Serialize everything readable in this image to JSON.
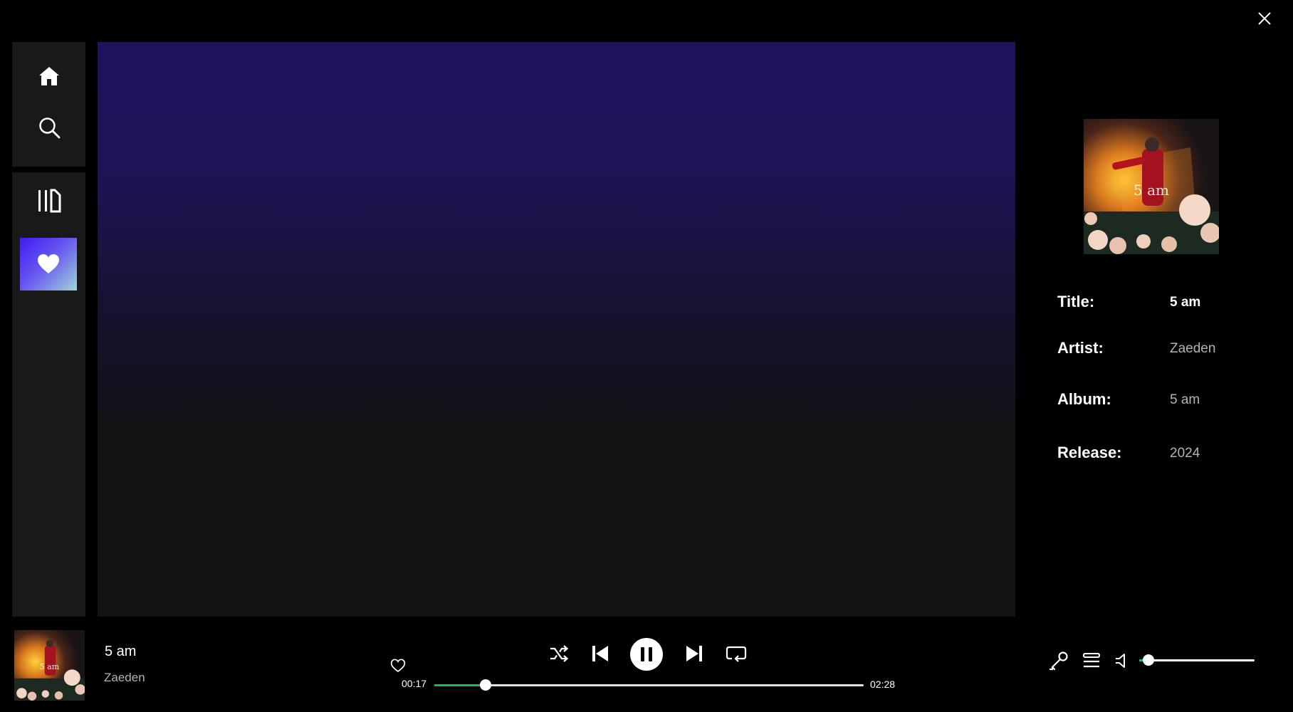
{
  "window": {
    "close_icon": "close-icon"
  },
  "sidebar": {
    "items": [
      {
        "icon": "home-icon"
      },
      {
        "icon": "search-icon"
      },
      {
        "icon": "library-icon"
      },
      {
        "icon": "heart-icon"
      }
    ]
  },
  "now_playing_panel": {
    "cover_text": "5 am",
    "fields": [
      {
        "label": "Title:",
        "value": "5 am"
      },
      {
        "label": "Artist:",
        "value": "Zaeden"
      },
      {
        "label": "Album:",
        "value": "5 am"
      },
      {
        "label": "Release:",
        "value": "2024"
      }
    ]
  },
  "player": {
    "cover_text": "5 am",
    "track_title": "5 am",
    "track_artist": "Zaeden",
    "elapsed": "00:17",
    "duration": "02:28",
    "progress_fraction": 0.12,
    "volume_fraction": 0.08,
    "colors": {
      "accent": "#1db954",
      "liked_gradient_start": "#3f1cf0",
      "liked_gradient_end": "#9fd6d8"
    },
    "controls": [
      "heart-outline-icon",
      "shuffle-icon",
      "previous-icon",
      "pause-icon",
      "next-icon",
      "repeat-icon",
      "microphone-icon",
      "queue-icon",
      "volume-icon"
    ]
  }
}
